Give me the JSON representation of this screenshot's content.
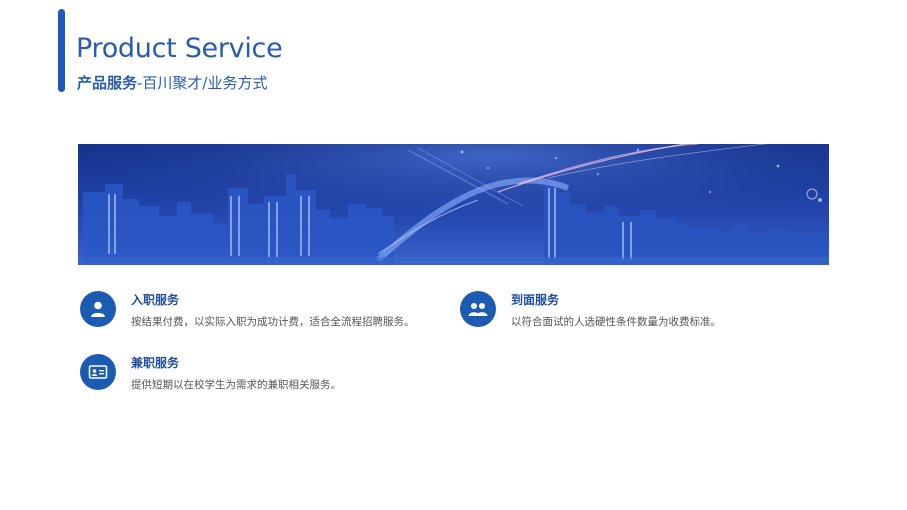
{
  "header": {
    "title": "Product Service",
    "subtitle_bold": "产品服务",
    "subtitle_rest": "-百川聚才/业务方式"
  },
  "features": [
    {
      "title": "入职服务",
      "desc": "按结果付费，以实际入职为成功计费，适合全流程招聘服务。",
      "icon": "user-icon"
    },
    {
      "title": "到面服务",
      "desc": "以符合面试的人选硬性条件数量为收费标准。",
      "icon": "two-users-icon"
    },
    {
      "title": "兼职服务",
      "desc": "提供短期以在校学生为需求的兼职相关服务。",
      "icon": "id-card-icon"
    }
  ],
  "colors": {
    "accent": "#1f58b8",
    "title": "#2a5cab",
    "icon_bg": "#1b5bb1",
    "banner_sky": "#1e3f9c"
  }
}
